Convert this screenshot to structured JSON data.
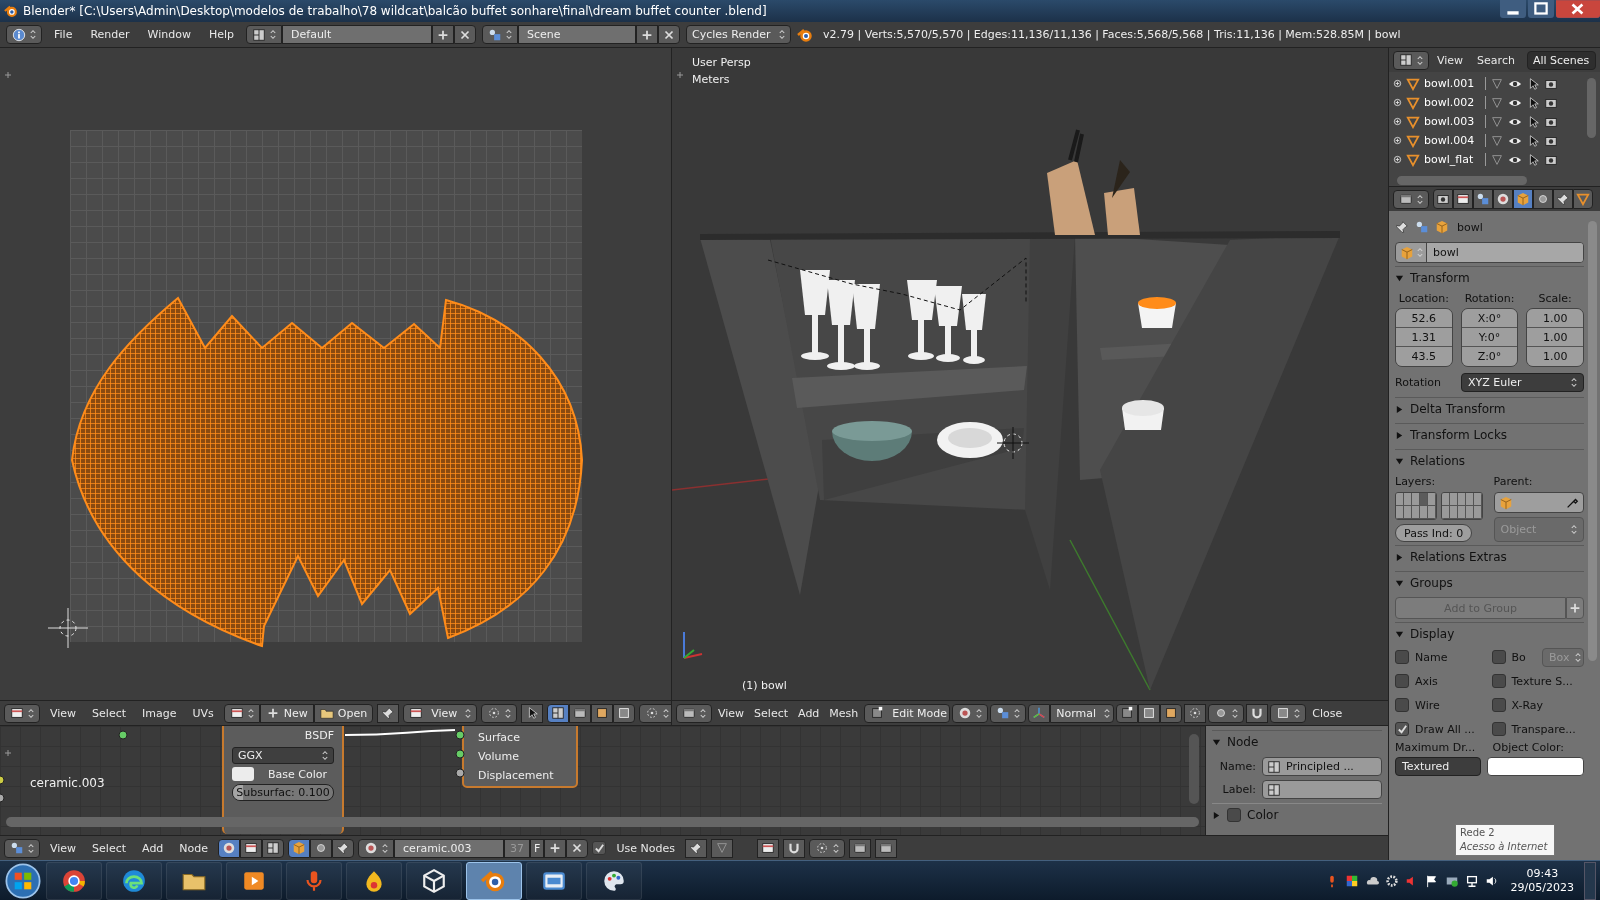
{
  "window": {
    "title": "Blender* [C:\\Users\\Admin\\Desktop\\modelos de trabalho\\78 wildcat\\balcão buffet sonhare\\final\\dream buffet counter .blend]"
  },
  "info_header": {
    "menus": [
      "File",
      "Render",
      "Window",
      "Help"
    ],
    "screen_layout": "Default",
    "scene": "Scene",
    "render_engine": "Cycles Render",
    "stats": "v2.79 | Verts:5,570/5,570 | Edges:11,136/11,136 | Faces:5,568/5,568 | Tris:11,136 | Mem:528.85M | bowl"
  },
  "uv_editor": {
    "menus": [
      "View",
      "Select",
      "Image",
      "UVs"
    ],
    "new_button": "New",
    "open_button": "Open",
    "view_dropdown": "View",
    "select_modes": [
      {
        "selected": true
      },
      {
        "selected": false
      },
      {
        "selected": false
      },
      {
        "selected": false
      }
    ]
  },
  "viewport": {
    "view_name": "User Persp",
    "units": "Meters",
    "object_label": "(1) bowl",
    "menus": [
      "View",
      "Select",
      "Add",
      "Mesh"
    ],
    "mode": "Edit Mode",
    "orientation": "Normal",
    "close_label": "Close"
  },
  "outliner": {
    "menus": [
      "View",
      "Search"
    ],
    "filter": "All Scenes",
    "items": [
      {
        "name": "bowl.001"
      },
      {
        "name": "bowl.002"
      },
      {
        "name": "bowl.003"
      },
      {
        "name": "bowl.004"
      },
      {
        "name": "bowl_flat"
      }
    ]
  },
  "properties": {
    "tabs": [
      {
        "kind": "render",
        "selected": false
      },
      {
        "kind": "layers",
        "selected": false
      },
      {
        "kind": "scene",
        "selected": false
      },
      {
        "kind": "world",
        "selected": false
      },
      {
        "kind": "object",
        "selected": true
      },
      {
        "kind": "constraints",
        "selected": false
      },
      {
        "kind": "modifiers",
        "selected": false
      },
      {
        "kind": "data",
        "selected": false
      }
    ],
    "breadcrumb": "bowl",
    "object_name": "bowl",
    "transform": {
      "title": "Transform",
      "expanded": true,
      "location_label": "Location:",
      "rotation_label": "Rotation:",
      "scale_label": "Scale:",
      "location": [
        "52.6",
        "1.31",
        "43.5"
      ],
      "rotation": [
        "X:0°",
        "Y:0°",
        "Z:0°"
      ],
      "scale": [
        "1.00",
        "1.00",
        "1.00"
      ],
      "rotation_mode_label": "Rotation",
      "rotation_mode": "XYZ Euler"
    },
    "delta_transform": {
      "title": "Delta Transform",
      "expanded": false
    },
    "transform_locks": {
      "title": "Transform Locks",
      "expanded": false
    },
    "relations": {
      "title": "Relations",
      "expanded": true,
      "layers_label": "Layers:",
      "parent_label": "Parent:",
      "parent_type": "Object",
      "pass_index": "Pass Ind: 0",
      "layers": [
        {
          "on": false
        },
        {
          "on": false
        },
        {
          "on": false
        },
        {
          "on": true
        },
        {
          "on": false
        },
        {
          "on": false
        },
        {
          "on": false
        },
        {
          "on": false
        },
        {
          "on": false
        },
        {
          "on": false
        },
        {
          "on": false
        },
        {
          "on": false
        },
        {
          "on": false
        },
        {
          "on": false
        },
        {
          "on": false
        },
        {
          "on": false
        },
        {
          "on": false
        },
        {
          "on": false
        },
        {
          "on": false
        },
        {
          "on": false
        }
      ]
    },
    "relations_extras": {
      "title": "Relations Extras",
      "expanded": false
    },
    "groups": {
      "title": "Groups",
      "expanded": true,
      "add_button": "Add to Group"
    },
    "display": {
      "title": "Display",
      "expanded": true,
      "checkboxes": [
        {
          "label": "Name",
          "checked": false
        },
        {
          "label": "Bo",
          "checked": false,
          "dropdown": "Box"
        },
        {
          "label": "Axis",
          "checked": false
        },
        {
          "label": "Texture S...",
          "checked": false
        },
        {
          "label": "Wire",
          "checked": false
        },
        {
          "label": "X-Ray",
          "checked": false
        },
        {
          "label": "Draw All ...",
          "checked": true
        },
        {
          "label": "Transpare...",
          "checked": false
        }
      ],
      "max_draw_label": "Maximum Dr...",
      "object_color_label": "Object Color:",
      "max_draw_type": "Textured"
    }
  },
  "node_editor": {
    "material_label": "ceramic.003",
    "principled_node": {
      "output": "BSDF",
      "distribution": "GGX",
      "base_color": "Base Color",
      "subsurface": {
        "text": "Subsurfac: 0.100",
        "level": 0.1
      }
    },
    "output_node": {
      "inputs": [
        "Surface",
        "Volume",
        "Displacement"
      ]
    },
    "sidebar": {
      "node_panel": {
        "title": "Node",
        "expanded": true,
        "name_label": "Name:",
        "name_value": "Principled ...",
        "label_label": "Label:"
      },
      "color_panel": {
        "title": "Color",
        "expanded": false,
        "checked": false
      }
    },
    "header": {
      "menus": [
        "View",
        "Select",
        "Add",
        "Node"
      ],
      "material": "ceramic.003",
      "users": "37",
      "fake_user": "F",
      "use_nodes_label": "Use Nodes",
      "use_nodes": true
    }
  },
  "network_tooltip": {
    "title": "Rede 2",
    "subtitle": "Acesso à Internet"
  },
  "taskbar": {
    "apps": [
      {
        "kind": "chrome",
        "selected": false
      },
      {
        "kind": "edge",
        "selected": false
      },
      {
        "kind": "folder",
        "selected": false
      },
      {
        "kind": "player",
        "selected": false
      },
      {
        "kind": "mic",
        "selected": false
      },
      {
        "kind": "game",
        "selected": false
      },
      {
        "kind": "unity",
        "selected": false
      },
      {
        "kind": "blender",
        "selected": true
      },
      {
        "kind": "window",
        "selected": false
      },
      {
        "kind": "paint",
        "selected": false
      }
    ],
    "clock": {
      "time": "09:43",
      "date": "29/05/2023"
    }
  }
}
